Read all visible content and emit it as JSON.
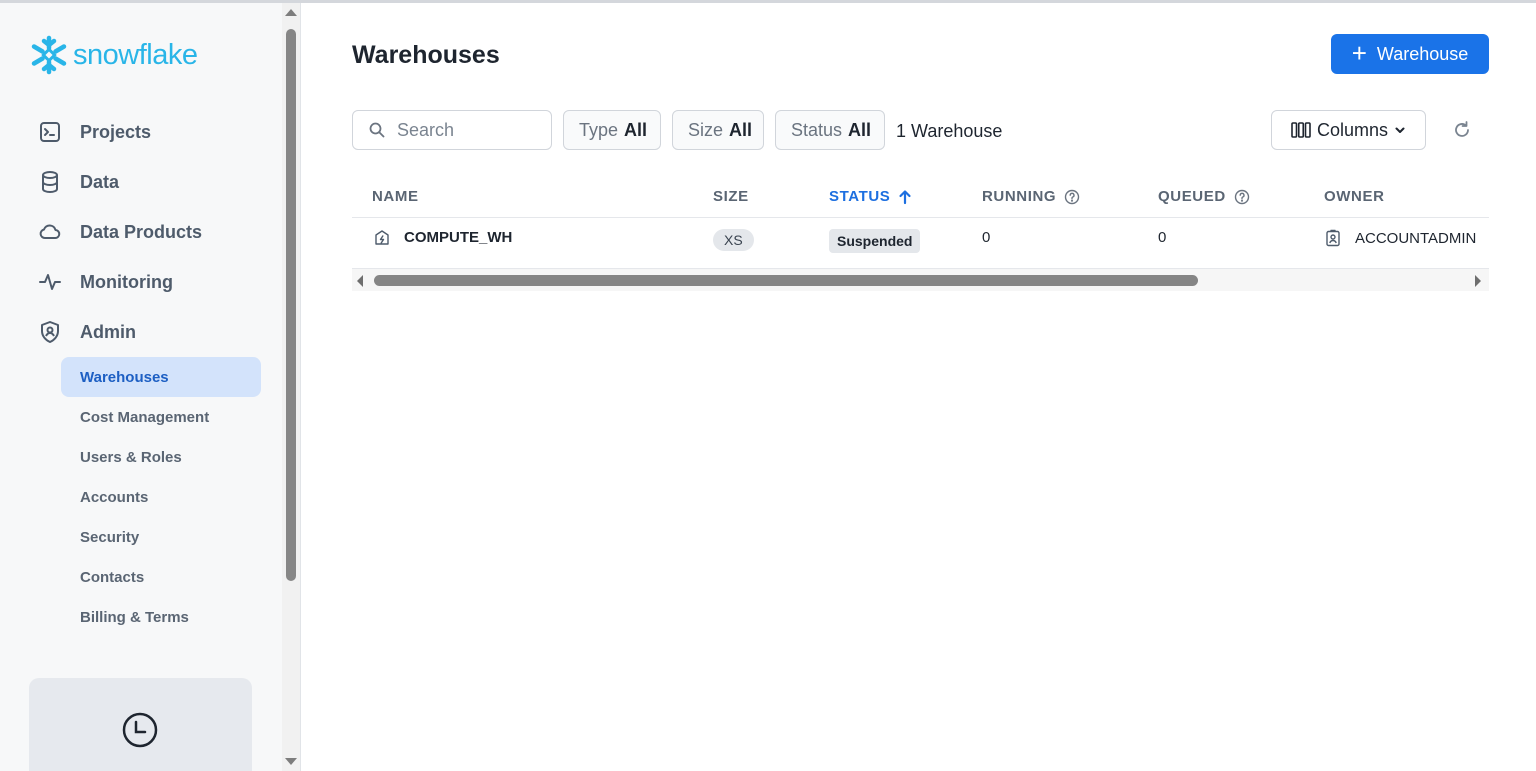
{
  "app": {
    "brand": "snowflake",
    "brand_color": "#29b5e8",
    "accent_color": "#1a73e8"
  },
  "sidebar": {
    "nav": [
      {
        "label": "Projects",
        "icon": "terminal-icon"
      },
      {
        "label": "Data",
        "icon": "database-icon"
      },
      {
        "label": "Data Products",
        "icon": "cloud-icon"
      },
      {
        "label": "Monitoring",
        "icon": "activity-icon"
      },
      {
        "label": "Admin",
        "icon": "shield-user-icon"
      }
    ],
    "admin_items": [
      {
        "label": "Warehouses",
        "active": true
      },
      {
        "label": "Cost Management"
      },
      {
        "label": "Users & Roles"
      },
      {
        "label": "Accounts"
      },
      {
        "label": "Security"
      },
      {
        "label": "Contacts"
      },
      {
        "label": "Billing & Terms"
      }
    ],
    "recent_icon": "clock-icon"
  },
  "main": {
    "title": "Warehouses",
    "add_button": "Warehouse",
    "search": {
      "placeholder": "Search",
      "value": ""
    },
    "filters": [
      {
        "label": "Type",
        "value": "All"
      },
      {
        "label": "Size",
        "value": "All"
      },
      {
        "label": "Status",
        "value": "All"
      }
    ],
    "count": "1 Warehouse",
    "columns_button": "Columns",
    "table": {
      "columns": [
        "NAME",
        "SIZE",
        "STATUS",
        "RUNNING",
        "QUEUED",
        "OWNER"
      ],
      "sorted_column": "STATUS",
      "rows": [
        {
          "name": "COMPUTE_WH",
          "size": "XS",
          "status": "Suspended",
          "running": "0",
          "queued": "0",
          "owner": "ACCOUNTADMIN"
        }
      ]
    }
  }
}
